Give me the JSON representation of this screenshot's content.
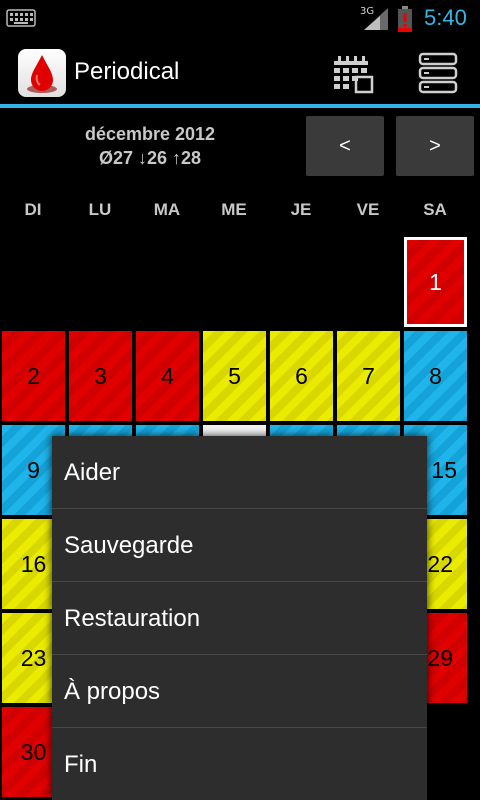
{
  "status_bar": {
    "network": "3G",
    "time": "5:40"
  },
  "action_bar": {
    "title": "Periodical",
    "logo_icon": "blood-drop-icon",
    "calendar_icon": "calendar-icon",
    "menu_icon": "overflow-menu-icon",
    "accent_color": "#33b5e5"
  },
  "calendar_header": {
    "month": "décembre 2012",
    "stats": "Ø27 ↓26 ↑28",
    "prev_label": "<",
    "next_label": ">"
  },
  "weekdays": [
    "DI",
    "LU",
    "MA",
    "ME",
    "JE",
    "VE",
    "SA"
  ],
  "days": [
    {
      "day": "1",
      "color": "red",
      "today": true
    },
    {
      "day": "2",
      "color": "red"
    },
    {
      "day": "3",
      "color": "red"
    },
    {
      "day": "4",
      "color": "red"
    },
    {
      "day": "5",
      "color": "yellow"
    },
    {
      "day": "6",
      "color": "yellow"
    },
    {
      "day": "7",
      "color": "yellow"
    },
    {
      "day": "8",
      "color": "blue"
    },
    {
      "day": "9",
      "color": "blue"
    },
    {
      "day": "15",
      "color": "blue"
    },
    {
      "day": "16",
      "color": "yellow"
    },
    {
      "day": "22",
      "color": "yellow"
    },
    {
      "day": "23",
      "color": "yellow"
    },
    {
      "day": "29",
      "color": "red"
    },
    {
      "day": "30",
      "color": "red"
    }
  ],
  "overflow_menu": {
    "items": [
      "Aider",
      "Sauvegarde",
      "Restauration",
      "À propos",
      "Fin"
    ]
  },
  "colors": {
    "period": "#e00000",
    "fertile": "#ebeb00",
    "normal": "#1fb4ea"
  }
}
